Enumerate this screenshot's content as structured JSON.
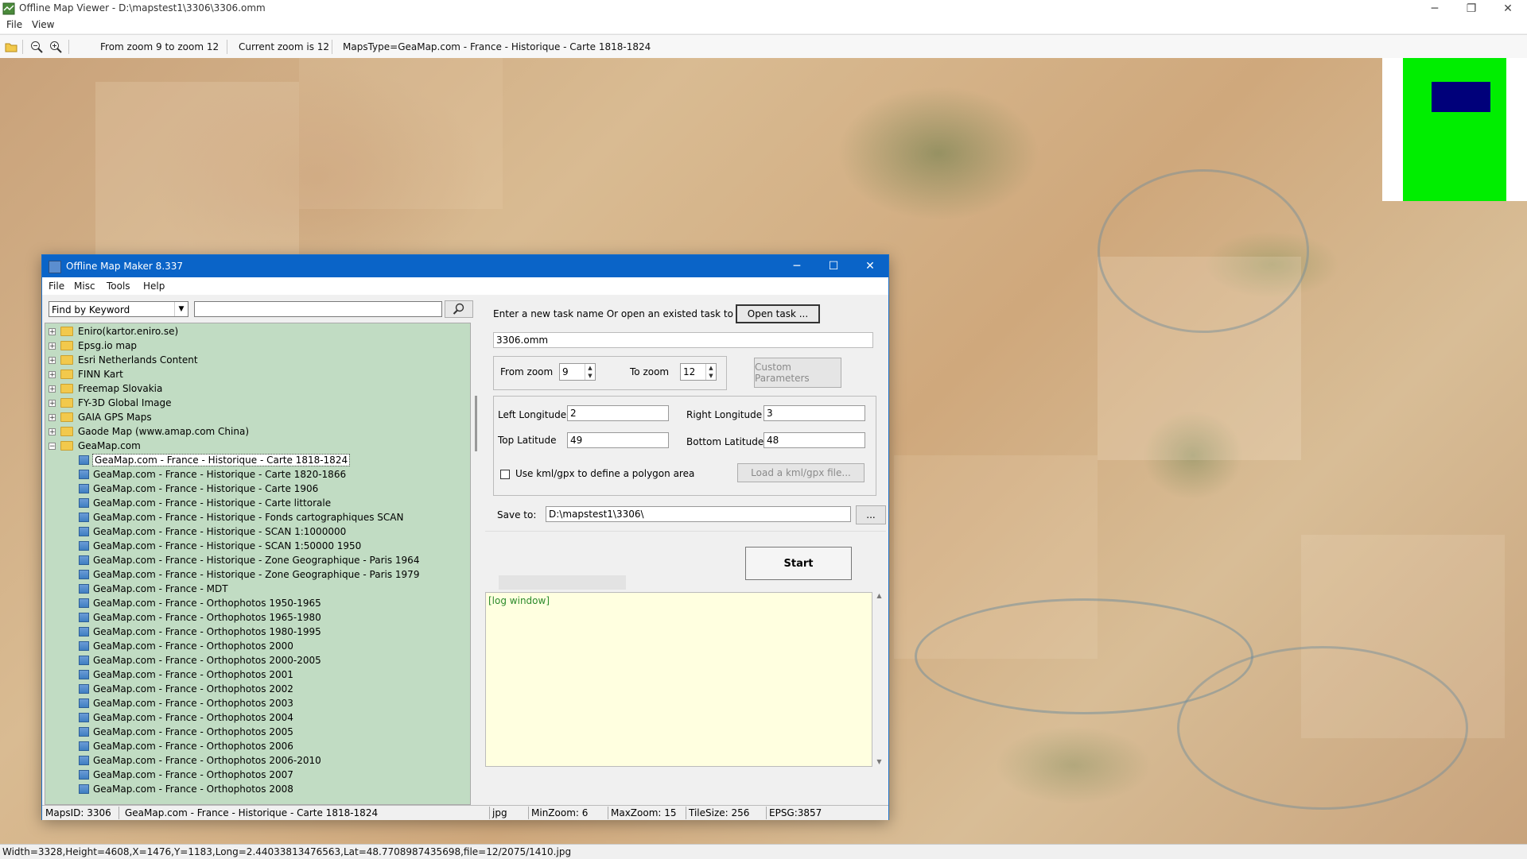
{
  "viewer": {
    "title": "Offline Map Viewer - D:\\mapstest1\\3306\\3306.omm",
    "menu": [
      "File",
      "View"
    ],
    "toolbar": {
      "zoom_range": "From zoom 9 to zoom 12",
      "current_zoom": "Current zoom is 12",
      "maps_type": "MapsType=GeaMap.com - France - Historique - Carte 1818-1824"
    },
    "status": "Width=3328,Height=4608,X=1476,Y=1183,Long=2.44033813476563,Lat=48.7708987435698,file=12/2075/1410.jpg"
  },
  "dialog": {
    "title": "Offline Map Maker 8.337",
    "menu": [
      "File",
      "Misc",
      "Tools",
      "Help"
    ],
    "search": {
      "mode": "Find by Keyword",
      "query": ""
    },
    "tree": [
      {
        "type": "folder",
        "label": "Eniro(kartor.eniro.se)",
        "expanded": false
      },
      {
        "type": "folder",
        "label": "Epsg.io map",
        "expanded": false
      },
      {
        "type": "folder",
        "label": "Esri Netherlands Content",
        "expanded": false
      },
      {
        "type": "folder",
        "label": "FINN Kart",
        "expanded": false
      },
      {
        "type": "folder",
        "label": "Freemap Slovakia",
        "expanded": false
      },
      {
        "type": "folder",
        "label": "FY-3D Global Image",
        "expanded": false
      },
      {
        "type": "folder",
        "label": "GAIA GPS Maps",
        "expanded": false
      },
      {
        "type": "folder",
        "label": "Gaode Map (www.amap.com China)",
        "expanded": false
      },
      {
        "type": "folder",
        "label": "GeaMap.com",
        "expanded": true
      },
      {
        "type": "map",
        "label": "GeaMap.com - France - Historique - Carte 1818-1824",
        "selected": true
      },
      {
        "type": "map",
        "label": "GeaMap.com - France - Historique - Carte 1820-1866"
      },
      {
        "type": "map",
        "label": "GeaMap.com - France - Historique - Carte 1906"
      },
      {
        "type": "map",
        "label": "GeaMap.com - France - Historique - Carte littorale"
      },
      {
        "type": "map",
        "label": "GeaMap.com - France - Historique - Fonds cartographiques SCAN"
      },
      {
        "type": "map",
        "label": "GeaMap.com - France - Historique - SCAN 1:1000000"
      },
      {
        "type": "map",
        "label": "GeaMap.com - France - Historique - SCAN 1:50000 1950"
      },
      {
        "type": "map",
        "label": "GeaMap.com - France - Historique - Zone Geographique - Paris 1964"
      },
      {
        "type": "map",
        "label": "GeaMap.com - France - Historique - Zone Geographique - Paris 1979"
      },
      {
        "type": "map",
        "label": "GeaMap.com - France - MDT"
      },
      {
        "type": "map",
        "label": "GeaMap.com - France - Orthophotos 1950-1965"
      },
      {
        "type": "map",
        "label": "GeaMap.com - France - Orthophotos 1965-1980"
      },
      {
        "type": "map",
        "label": "GeaMap.com - France - Orthophotos 1980-1995"
      },
      {
        "type": "map",
        "label": "GeaMap.com - France - Orthophotos 2000"
      },
      {
        "type": "map",
        "label": "GeaMap.com - France - Orthophotos 2000-2005"
      },
      {
        "type": "map",
        "label": "GeaMap.com - France - Orthophotos 2001"
      },
      {
        "type": "map",
        "label": "GeaMap.com - France - Orthophotos 2002"
      },
      {
        "type": "map",
        "label": "GeaMap.com - France - Orthophotos 2003"
      },
      {
        "type": "map",
        "label": "GeaMap.com - France - Orthophotos 2004"
      },
      {
        "type": "map",
        "label": "GeaMap.com - France - Orthophotos 2005"
      },
      {
        "type": "map",
        "label": "GeaMap.com - France - Orthophotos 2006"
      },
      {
        "type": "map",
        "label": "GeaMap.com - France - Orthophotos 2006-2010"
      },
      {
        "type": "map",
        "label": "GeaMap.com - France - Orthophotos 2007"
      },
      {
        "type": "map",
        "label": "GeaMap.com - France - Orthophotos 2008"
      }
    ],
    "task": {
      "prompt": "Enter a new task name Or open an existed task to continue:",
      "open_button": "Open task ...",
      "name": "3306.omm"
    },
    "zoom": {
      "from_label": "From zoom",
      "from_value": "9",
      "to_label": "To zoom",
      "to_value": "12",
      "custom_button": "Custom Parameters"
    },
    "coords": {
      "left_lon_label": "Left Longitude",
      "left_lon": "2",
      "right_lon_label": "Right Longitude",
      "right_lon": "3",
      "top_lat_label": "Top Latitude",
      "top_lat": "49",
      "bottom_lat_label": "Bottom Latitude",
      "bottom_lat": "48",
      "kml_checkbox_label": "Use kml/gpx to define a polygon area",
      "kml_checked": false,
      "kml_button": "Load a kml/gpx file..."
    },
    "save": {
      "label": "Save to:",
      "path": "D:\\mapstest1\\3306\\",
      "browse": "..."
    },
    "start_button": "Start",
    "log": "[log window]",
    "status": {
      "maps_id": "MapsID: 3306",
      "map_name": "GeaMap.com - France - Historique - Carte 1818-1824",
      "format": "jpg",
      "min_zoom": "MinZoom: 6",
      "max_zoom": "MaxZoom: 15",
      "tile_size": "TileSize: 256",
      "epsg": "EPSG:3857"
    }
  },
  "colors": {
    "dialog_titlebar": "#0a64c8",
    "tree_background": "#c1dcc3",
    "log_background": "#ffffe0",
    "overview_green": "#00ee00",
    "overview_viewport": "#00007a"
  }
}
